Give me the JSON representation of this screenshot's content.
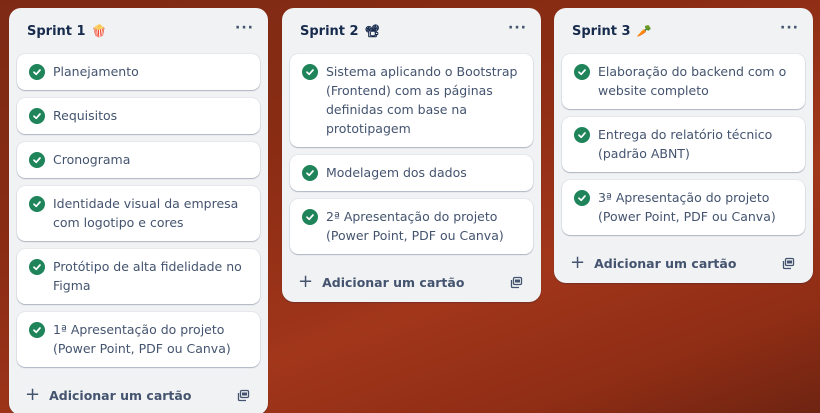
{
  "lists": [
    {
      "title": "Sprint 1",
      "emoji": "🍿",
      "menu": "···",
      "cards": [
        "Planejamento",
        "Requisitos",
        "Cronograma",
        "Identidade visual da empresa com logotipo e cores",
        "Protótipo de alta fidelidade no Figma",
        "1ª Apresentação do projeto (Power Point, PDF ou Canva)"
      ],
      "add_label": "Adicionar um cartão"
    },
    {
      "title": "Sprint 2",
      "emoji": "📽",
      "menu": "···",
      "cards": [
        "Sistema aplicando o Bootstrap (Frontend) com as páginas definidas com base na prototipagem",
        "Modelagem dos dados",
        "2ª Apresentação do projeto (Power Point, PDF ou Canva)"
      ],
      "add_label": "Adicionar um cartão"
    },
    {
      "title": "Sprint 3",
      "emoji": "🥕",
      "menu": "···",
      "cards": [
        "Elaboração do backend com o website completo",
        "Entrega do relatório técnico (padrão ABNT)",
        "3ª Apresentação do projeto (Power Point, PDF ou Canva)"
      ],
      "add_label": "Adicionar um cartão"
    }
  ],
  "icons": {
    "card_status": "check-circle-icon",
    "add": "plus-icon",
    "template": "card-template-icon",
    "menu": "more-icon"
  },
  "colors": {
    "check": "#1f845a",
    "list_bg": "#f1f2f4",
    "board_bg": "#8a2c14"
  }
}
